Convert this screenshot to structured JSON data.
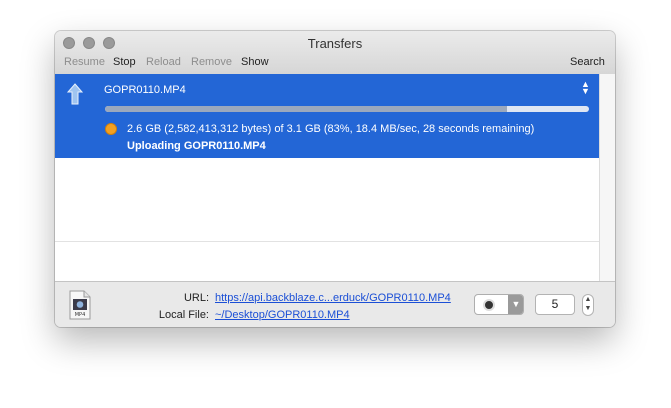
{
  "window": {
    "title": "Transfers"
  },
  "toolbar": {
    "resume": "Resume",
    "stop": "Stop",
    "reload": "Reload",
    "remove": "Remove",
    "show": "Show",
    "search": "Search"
  },
  "transfer": {
    "filename": "GOPR0110.MP4",
    "progress_fraction": 0.83,
    "progress_text": "2.6 GB (2,582,413,312 bytes) of 3.1 GB (83%, 18.4 MB/sec, 28 seconds remaining)",
    "status": "Uploading GOPR0110.MP4"
  },
  "details": {
    "url_label": "URL:",
    "url_value": "https://api.backblaze.c...erduck/GOPR0110.MP4",
    "local_label": "Local File:",
    "local_value": "~/Desktop/GOPR0110.MP4",
    "file_icon_text": "MP4",
    "connections_count": "5"
  },
  "colors": {
    "selection": "#2366d6",
    "progress_fill": "#9ba8bd",
    "status_dot": "#f3a021",
    "link": "#1b4fd6"
  }
}
